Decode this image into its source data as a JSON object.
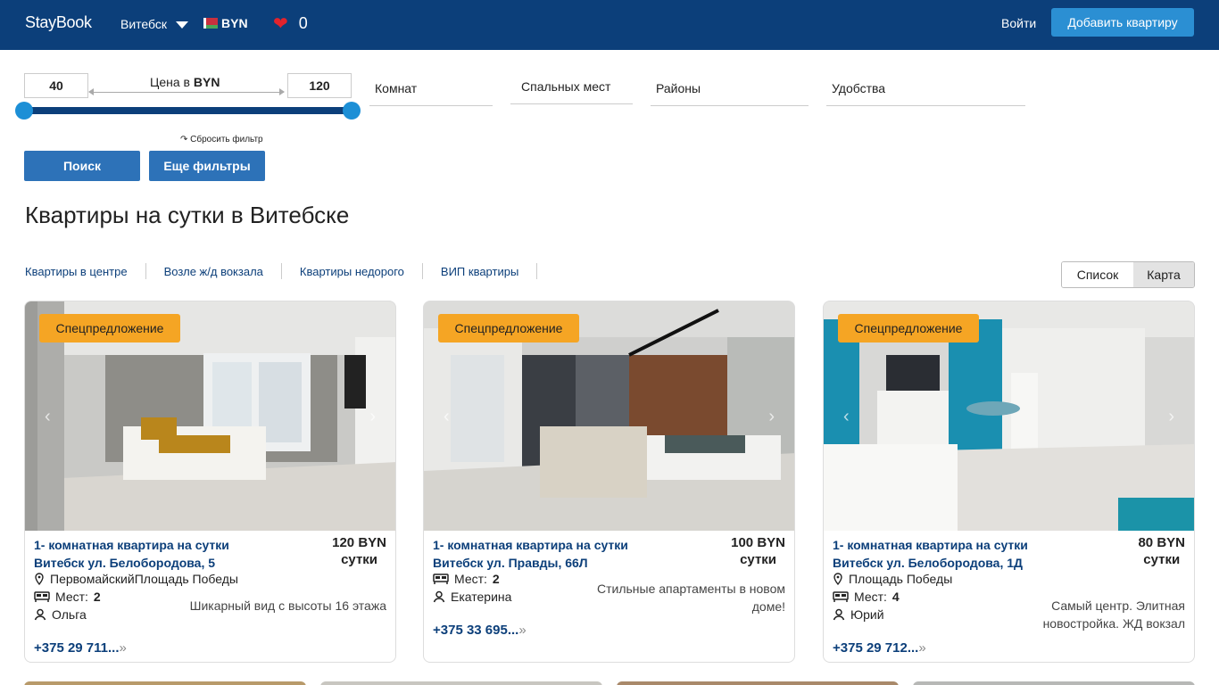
{
  "header": {
    "logo": "StayBook",
    "city": "Витебск",
    "currency": "BYN",
    "favorites_count": "0",
    "login": "Войти",
    "add_button": "Добавить квартиру"
  },
  "filters": {
    "price_min": "40",
    "price_max": "120",
    "price_label_prefix": "Цена в",
    "price_label_currency": "BYN",
    "rooms": "Комнат",
    "beds": "Спальных мест",
    "districts": "Районы",
    "amenities": "Удобства",
    "reset": "Сбросить фильтр",
    "search_button": "Поиск",
    "more_button": "Еще фильтры"
  },
  "page_title": "Квартиры на сутки в Витебске",
  "quick_links": [
    "Квартиры в центре",
    "Возле ж/д вокзала",
    "Квартиры недорого",
    "ВИП квартиры"
  ],
  "view_toggle": {
    "list": "Список",
    "map": "Карта"
  },
  "cards": [
    {
      "badge": "Спецпредложение",
      "title_line1": "1- комнатная квартира на сутки",
      "title_line2": "Витебск ул. Белобородова, 5",
      "price": "120 BYN",
      "period": "сутки",
      "district": "ПервомайскийПлощадь Победы",
      "places_label": "Мест:",
      "places": "2",
      "owner": "Ольга",
      "description": "Шикарный вид с высоты 16 этажа",
      "phone": "+375 29 711..."
    },
    {
      "badge": "Спецпредложение",
      "title_line1": "1- комнатная квартира на сутки",
      "title_line2": "Витебск ул. Правды, 66Л",
      "price": "100 BYN",
      "period": "сутки",
      "district": "",
      "places_label": "Мест:",
      "places": "2",
      "owner": "Екатерина",
      "description": "Стильные апартаменты в новом доме!",
      "phone": "+375 33 695..."
    },
    {
      "badge": "Спецпредложение",
      "title_line1": "1- комнатная квартира на сутки",
      "title_line2": "Витебск ул. Белобородова, 1Д",
      "price": "80 BYN",
      "period": "сутки",
      "district": "Площадь Победы",
      "places_label": "Мест:",
      "places": "4",
      "owner": "Юрий",
      "description": "Самый центр. Элитная новостройка. ЖД вокзал",
      "phone": "+375 29 712..."
    }
  ],
  "colors": {
    "header_bg": "#0c3f7a",
    "accent_button": "#2b8fd3",
    "badge": "#f5a524",
    "link": "#0c3f7a"
  },
  "icons": [
    "caret-down-icon",
    "flag-icon",
    "heart-icon",
    "location-icon",
    "bed-icon",
    "user-icon",
    "chevron-right-icon"
  ]
}
